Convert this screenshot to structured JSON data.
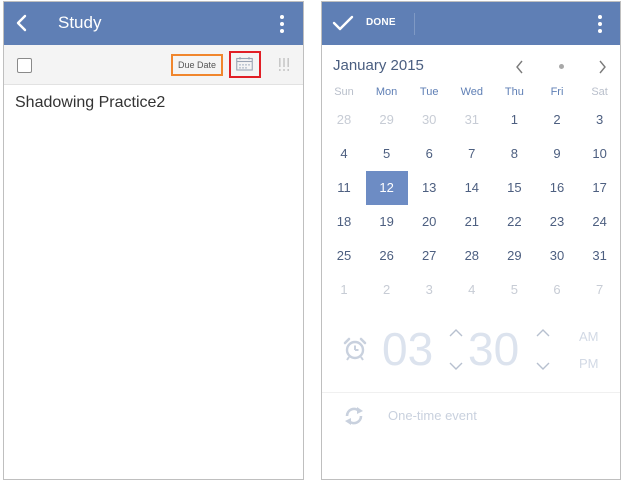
{
  "left_screen": {
    "appbar": {
      "title": "Study"
    },
    "toolbar": {
      "due_date_label": "Due Date"
    },
    "task": {
      "title": "Shadowing Practice2"
    }
  },
  "right_screen": {
    "appbar": {
      "done_label": "DONE"
    },
    "calendar": {
      "month_label": "January 2015",
      "weekdays": [
        "Sun",
        "Mon",
        "Tue",
        "Wed",
        "Thu",
        "Fri",
        "Sat"
      ],
      "weeks": [
        [
          "28",
          "29",
          "30",
          "31",
          "1",
          "2",
          "3"
        ],
        [
          "4",
          "5",
          "6",
          "7",
          "8",
          "9",
          "10"
        ],
        [
          "11",
          "12",
          "13",
          "14",
          "15",
          "16",
          "17"
        ],
        [
          "18",
          "19",
          "20",
          "21",
          "22",
          "23",
          "24"
        ],
        [
          "25",
          "26",
          "27",
          "28",
          "29",
          "30",
          "31"
        ],
        [
          "1",
          "2",
          "3",
          "4",
          "5",
          "6",
          "7"
        ]
      ],
      "selected_day": "12"
    },
    "time": {
      "hour": "03",
      "minute": "30",
      "am_label": "AM",
      "pm_label": "PM"
    },
    "repeat": {
      "label": "One-time event"
    }
  },
  "colors": {
    "appbar": "#5f7fb5",
    "selected_day": "#6d8cc4",
    "due_date_highlight": "#f0862d",
    "calendar_highlight": "#e11f26"
  }
}
